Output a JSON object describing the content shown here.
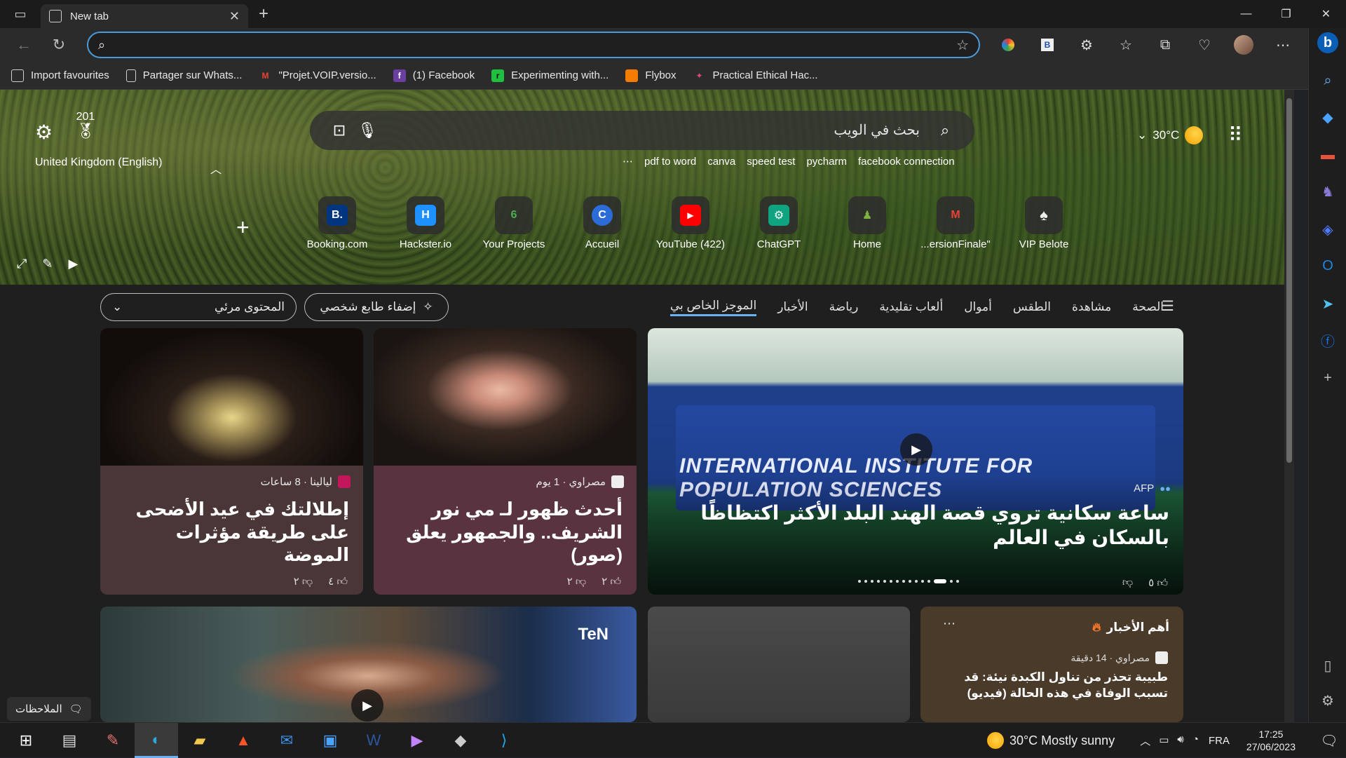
{
  "browser": {
    "tab_title": "New tab",
    "address_value": "",
    "favourites": [
      {
        "label": "Import favourites",
        "icon": "import-icon",
        "color": "#cfcfcf"
      },
      {
        "label": "Partager sur Whats...",
        "icon": "page-icon",
        "color": "#cfcfcf"
      },
      {
        "label": "\"Projet.VOIP.versio...",
        "icon": "gmail-icon",
        "color": "#ea4335"
      },
      {
        "label": "(1) Facebook",
        "icon": "facebook-icon",
        "color": "#6a3fa0"
      },
      {
        "label": "Experimenting with...",
        "icon": "replit-icon",
        "color": "#1fbf3f"
      },
      {
        "label": "Flybox",
        "icon": "flybox-icon",
        "color": "#f57c00"
      },
      {
        "label": "Practical Ethical Hac...",
        "icon": "hack-icon",
        "color": "#e0467c"
      }
    ]
  },
  "hero": {
    "rewards_count": "201",
    "region": "United Kingdom (English)",
    "search_placeholder": "بحث في الويب",
    "trending": [
      "pdf to word",
      "canva",
      "speed test",
      "pycharm",
      "facebook connection"
    ],
    "weather_temp": "30°C",
    "quick_links": [
      {
        "label": "Booking.com",
        "glyph": "B.",
        "color": "#003580"
      },
      {
        "label": "Hackster.io",
        "glyph": "H",
        "color": "#1e90ff"
      },
      {
        "label": "Your Projects",
        "glyph": "6",
        "color": "#2e7d32"
      },
      {
        "label": "Accueil",
        "glyph": "C",
        "color": "#2b6cd8"
      },
      {
        "label": "YouTube (422)",
        "glyph": "▶",
        "color": "#ff0000"
      },
      {
        "label": "ChatGPT",
        "glyph": "⚙",
        "color": "#10a37f"
      },
      {
        "label": "Home",
        "glyph": "♟",
        "color": "#5d8c3a"
      },
      {
        "label": "...ersionFinale\"",
        "glyph": "M",
        "color": "#ea4335"
      },
      {
        "label": "VIP Belote",
        "glyph": "♠",
        "color": "#444444"
      }
    ]
  },
  "feed": {
    "visible_content_label": "المحتوى مرئي",
    "personalize_label": "إضفاء طابع شخصي",
    "tabs": [
      "الموجز الخاص بي",
      "الأخبار",
      "رياضة",
      "ألعاب تقليدية",
      "أموال",
      "الطقس",
      "مشاهدة",
      "الصحة"
    ],
    "big_card": {
      "source": "AFP",
      "headline": "ساعة سكانية تروي قصة الهند البلد الأكثر اكتظاظًا بالسكان في العالم",
      "likes": "٥",
      "sign_text": "INTERNATIONAL INSTITUTE FOR POPULATION SCIENCES"
    },
    "card_a": {
      "source": "ليالينا · 8 ساعات",
      "headline": "إطلالتك في عيد الأضحى على طريقة مؤثرات الموضة",
      "likes": "٤",
      "dislikes": "٢"
    },
    "card_b": {
      "source": "مصراوي · 1 يوم",
      "headline": "أحدث ظهور لـ مي نور الشريف.. والجمهور يعلق (صور)",
      "likes": "٢",
      "dislikes": "٢"
    },
    "card_c": {
      "badge": "TeN"
    },
    "top_news": {
      "title": "أهم الأخبار",
      "source": "مصراوي · 14 دقيقة",
      "headline": "طبيبة تحذر من تناول الكبدة نيئة: قد تسبب الوفاة في هذه الحالة (فيديو)"
    },
    "notes_label": "الملاحظات"
  },
  "taskbar": {
    "weather": "30°C  Mostly sunny",
    "lang": "FRA",
    "time": "17:25",
    "date": "27/06/2023"
  }
}
